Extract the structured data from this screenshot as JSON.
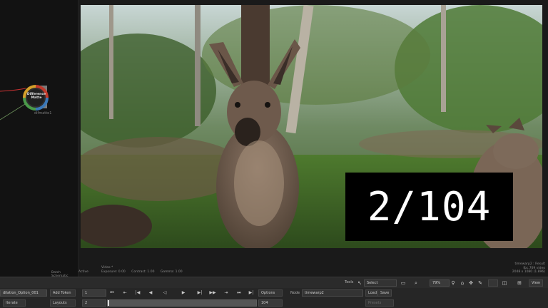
{
  "schematic": {
    "node_title": "Difference Matte",
    "node_name": "difmatte1",
    "footer_label": "Batch Schematic"
  },
  "viewer": {
    "frame_overlay": "2/104",
    "active_label": "Active",
    "channel": "Video *",
    "exposure": "Exposure: 0.00",
    "contrast": "Contrast: 1.00",
    "gamma": "Gamma: 1.00",
    "result_name": "timewarp2 : Result",
    "bit_depth": "fbc.709 video",
    "resolution": "2048 x 1080 (1.896)"
  },
  "toolbar": {
    "tools_label": "Tools",
    "select_label": "Select",
    "zoom_value": "79%",
    "view_label": "View"
  },
  "bar2": {
    "option_field": "dilation_Option_001",
    "add_token": "Add Token",
    "frame_start": "1",
    "options": "Options",
    "node_label": "Node",
    "node_value": "timewarp2",
    "load": "Load",
    "save": "Save"
  },
  "bar3": {
    "iterate": "Iterate",
    "layouts": "Layouts",
    "frame_current": "2",
    "frame_end": "104",
    "presets": "Presets"
  },
  "colors": {
    "accent": "#e0e0e0",
    "overlay_bg": "#000000",
    "wire": "#c83232"
  }
}
